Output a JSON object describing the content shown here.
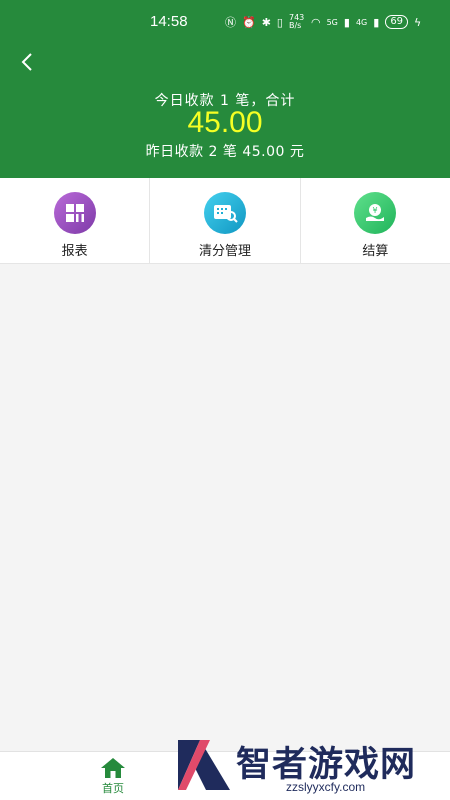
{
  "status_bar": {
    "time": "14:58",
    "network_speed": "743 B/s",
    "network_1": "5G",
    "network_2": "4G",
    "battery": "69"
  },
  "header": {
    "today_summary": "今日收款 1 笔，合计",
    "today_amount": "45.00",
    "yesterday_summary": "昨日收款 2 笔 45.00 元",
    "bg_color": "#268a3c",
    "amount_color": "#f5ff24"
  },
  "menu": {
    "items": [
      {
        "label": "报表",
        "icon": "report-grid-icon",
        "color": "#9b4fc4"
      },
      {
        "label": "清分管理",
        "icon": "clearing-search-icon",
        "color": "#1eafd6"
      },
      {
        "label": "结算",
        "icon": "settlement-coin-icon",
        "color": "#2fc46a"
      }
    ]
  },
  "bottom_nav": {
    "home_label": "首页",
    "home_icon": "home-icon"
  },
  "watermark": {
    "text": "智者游戏网",
    "url": "zzslyyxcfy.com"
  }
}
